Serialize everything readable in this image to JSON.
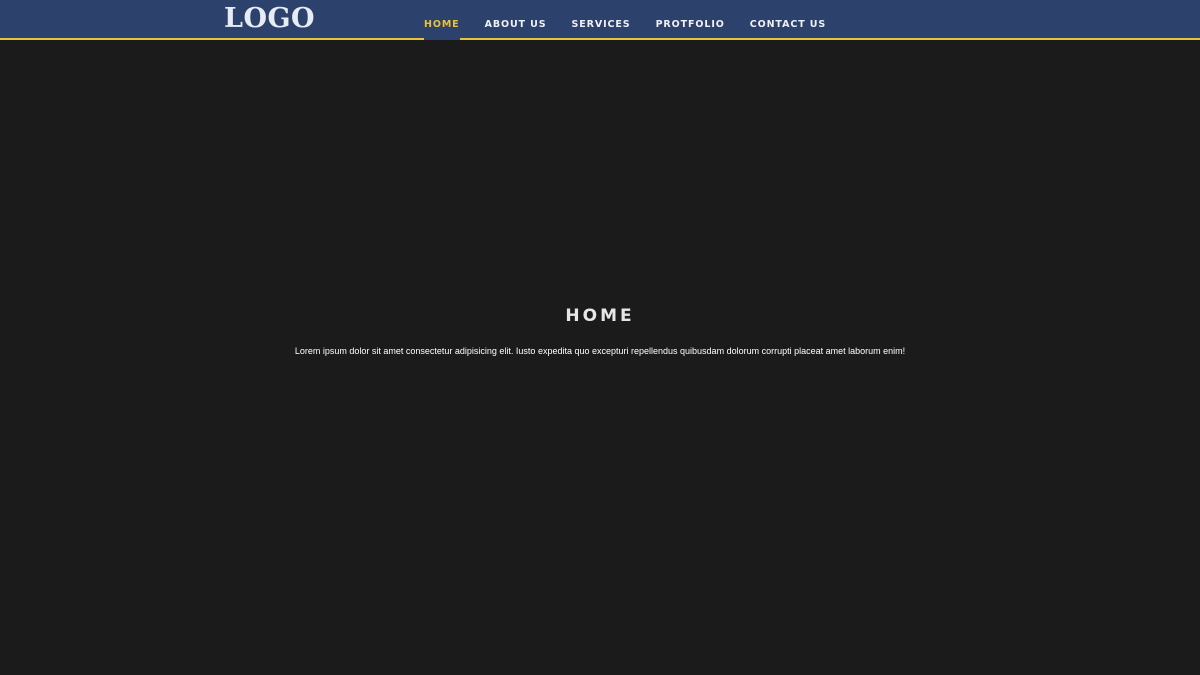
{
  "header": {
    "logo_text": "LOGO",
    "nav": [
      {
        "label": "HOME",
        "active": true
      },
      {
        "label": "ABOUT US",
        "active": false
      },
      {
        "label": "SERVICES",
        "active": false
      },
      {
        "label": "PROTFOLIO",
        "active": false
      },
      {
        "label": "CONTACT US",
        "active": false
      }
    ]
  },
  "hero": {
    "title": "HOME",
    "text": "Lorem ipsum dolor sit amet consectetur adipisicing elit. Iusto expedita quo excepturi repellendus quibusdam dolorum corrupti placeat amet laborum enim!"
  },
  "colors": {
    "header_bg": "#2c416b",
    "accent": "#e8c33a",
    "page_bg": "#1c1b1c"
  }
}
